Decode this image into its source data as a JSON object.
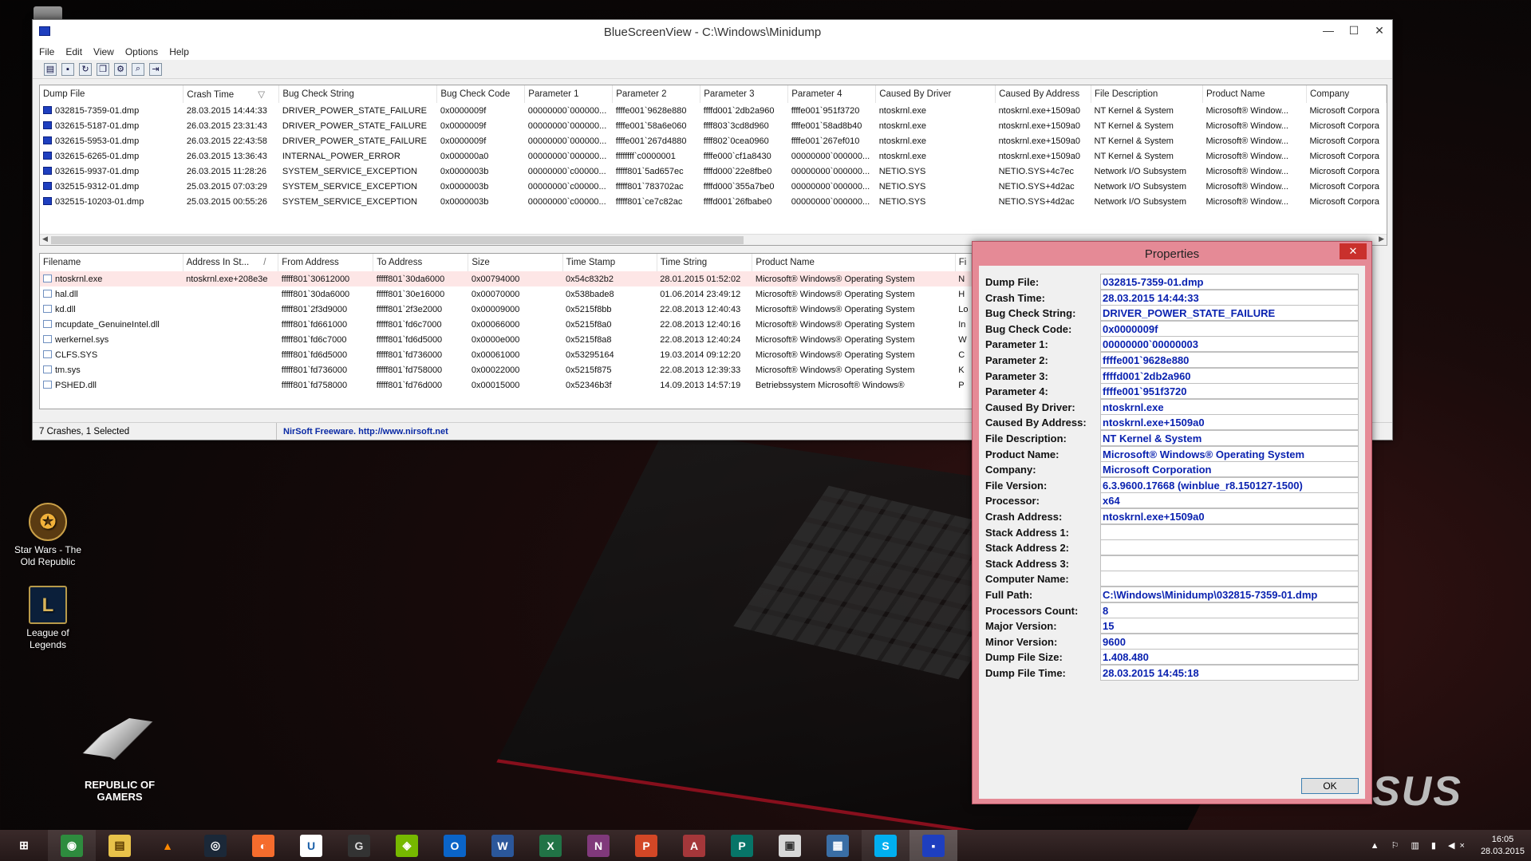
{
  "desktop": {
    "icons": [
      {
        "label": "Star Wars - The Old Republic",
        "icon": "swtor-icon"
      },
      {
        "label": "League of Legends",
        "icon": "league-icon"
      }
    ],
    "brand_text": "REPUBLIC OF GAMERS",
    "asus_text": "SUS"
  },
  "window": {
    "title": "BlueScreenView  -  C:\\Windows\\Minidump",
    "controls": {
      "minimize": "—",
      "maximize": "☐",
      "close": "✕"
    },
    "menu": [
      "File",
      "Edit",
      "View",
      "Options",
      "Help"
    ],
    "toolbar": [
      "properties-icon",
      "save-icon",
      "refresh-icon",
      "copy-icon",
      "options-icon",
      "find-icon",
      "exit-icon"
    ]
  },
  "dumps": {
    "columns": [
      "Dump File",
      "Crash Time",
      "Bug Check String",
      "Bug Check Code",
      "Parameter 1",
      "Parameter 2",
      "Parameter 3",
      "Parameter 4",
      "Caused By Driver",
      "Caused By Address",
      "File Description",
      "Product Name",
      "Company"
    ],
    "sort_indicator": "▽",
    "rows": [
      [
        "032815-7359-01.dmp",
        "28.03.2015 14:44:33",
        "DRIVER_POWER_STATE_FAILURE",
        "0x0000009f",
        "00000000`000000...",
        "ffffe001`9628e880",
        "ffffd001`2db2a960",
        "ffffe001`951f3720",
        "ntoskrnl.exe",
        "ntoskrnl.exe+1509a0",
        "NT Kernel & System",
        "Microsoft® Window...",
        "Microsoft Corpora"
      ],
      [
        "032615-5187-01.dmp",
        "26.03.2015 23:31:43",
        "DRIVER_POWER_STATE_FAILURE",
        "0x0000009f",
        "00000000`000000...",
        "ffffe001`58a6e060",
        "ffff803`3cd8d960",
        "ffffe001`58ad8b40",
        "ntoskrnl.exe",
        "ntoskrnl.exe+1509a0",
        "NT Kernel & System",
        "Microsoft® Window...",
        "Microsoft Corpora"
      ],
      [
        "032615-5953-01.dmp",
        "26.03.2015 22:43:58",
        "DRIVER_POWER_STATE_FAILURE",
        "0x0000009f",
        "00000000`000000...",
        "ffffe001`267d4880",
        "ffff802`0cea0960",
        "ffffe001`267ef010",
        "ntoskrnl.exe",
        "ntoskrnl.exe+1509a0",
        "NT Kernel & System",
        "Microsoft® Window...",
        "Microsoft Corpora"
      ],
      [
        "032615-6265-01.dmp",
        "26.03.2015 13:36:43",
        "INTERNAL_POWER_ERROR",
        "0x000000a0",
        "00000000`000000...",
        "ffffffff`c0000001",
        "ffffe000`cf1a8430",
        "00000000`000000...",
        "ntoskrnl.exe",
        "ntoskrnl.exe+1509a0",
        "NT Kernel & System",
        "Microsoft® Window...",
        "Microsoft Corpora"
      ],
      [
        "032615-9937-01.dmp",
        "26.03.2015 11:28:26",
        "SYSTEM_SERVICE_EXCEPTION",
        "0x0000003b",
        "00000000`c00000...",
        "fffff801`5ad657ec",
        "ffffd000`22e8fbe0",
        "00000000`000000...",
        "NETIO.SYS",
        "NETIO.SYS+4c7ec",
        "Network I/O Subsystem",
        "Microsoft® Window...",
        "Microsoft Corpora"
      ],
      [
        "032515-9312-01.dmp",
        "25.03.2015 07:03:29",
        "SYSTEM_SERVICE_EXCEPTION",
        "0x0000003b",
        "00000000`c00000...",
        "fffff801`783702ac",
        "ffffd000`355a7be0",
        "00000000`000000...",
        "NETIO.SYS",
        "NETIO.SYS+4d2ac",
        "Network I/O Subsystem",
        "Microsoft® Window...",
        "Microsoft Corpora"
      ],
      [
        "032515-10203-01.dmp",
        "25.03.2015 00:55:26",
        "SYSTEM_SERVICE_EXCEPTION",
        "0x0000003b",
        "00000000`c00000...",
        "fffff801`ce7c82ac",
        "ffffd001`26fbabe0",
        "00000000`000000...",
        "NETIO.SYS",
        "NETIO.SYS+4d2ac",
        "Network I/O Subsystem",
        "Microsoft® Window...",
        "Microsoft Corpora"
      ]
    ]
  },
  "modules": {
    "columns": [
      "Filename",
      "Address In St...",
      "From Address",
      "To Address",
      "Size",
      "Time Stamp",
      "Time String",
      "Product Name",
      "Fi"
    ],
    "sort_indicator": "/",
    "rows": [
      [
        "ntoskrnl.exe",
        "ntoskrnl.exe+208e3e",
        "fffff801`30612000",
        "fffff801`30da6000",
        "0x00794000",
        "0x54c832b2",
        "28.01.2015 01:52:02",
        "Microsoft® Windows® Operating System",
        "N"
      ],
      [
        "hal.dll",
        "",
        "fffff801`30da6000",
        "fffff801`30e16000",
        "0x00070000",
        "0x538bade8",
        "01.06.2014 23:49:12",
        "Microsoft® Windows® Operating System",
        "H"
      ],
      [
        "kd.dll",
        "",
        "fffff801`2f3d9000",
        "fffff801`2f3e2000",
        "0x00009000",
        "0x5215f8bb",
        "22.08.2013 12:40:43",
        "Microsoft® Windows® Operating System",
        "Lo"
      ],
      [
        "mcupdate_GenuineIntel.dll",
        "",
        "fffff801`fd661000",
        "fffff801`fd6c7000",
        "0x00066000",
        "0x5215f8a0",
        "22.08.2013 12:40:16",
        "Microsoft® Windows® Operating System",
        "In"
      ],
      [
        "werkernel.sys",
        "",
        "fffff801`fd6c7000",
        "fffff801`fd6d5000",
        "0x0000e000",
        "0x5215f8a8",
        "22.08.2013 12:40:24",
        "Microsoft® Windows® Operating System",
        "W"
      ],
      [
        "CLFS.SYS",
        "",
        "fffff801`fd6d5000",
        "fffff801`fd736000",
        "0x00061000",
        "0x53295164",
        "19.03.2014 09:12:20",
        "Microsoft® Windows® Operating System",
        "C"
      ],
      [
        "tm.sys",
        "",
        "fffff801`fd736000",
        "fffff801`fd758000",
        "0x00022000",
        "0x5215f875",
        "22.08.2013 12:39:33",
        "Microsoft® Windows® Operating System",
        "K"
      ],
      [
        "PSHED.dll",
        "",
        "fffff801`fd758000",
        "fffff801`fd76d000",
        "0x00015000",
        "0x52346b3f",
        "14.09.2013 14:57:19",
        "Betriebssystem Microsoft® Windows®",
        "P"
      ]
    ]
  },
  "status": {
    "count": "7 Crashes, 1 Selected",
    "link": "NirSoft Freeware.  http://www.nirsoft.net"
  },
  "properties": {
    "title": "Properties",
    "close": "✕",
    "ok": "OK",
    "fields": [
      {
        "label": "Dump File:",
        "value": "032815-7359-01.dmp"
      },
      {
        "label": "Crash Time:",
        "value": "28.03.2015 14:44:33"
      },
      {
        "label": "Bug Check String:",
        "value": "DRIVER_POWER_STATE_FAILURE"
      },
      {
        "label": "Bug Check Code:",
        "value": "0x0000009f"
      },
      {
        "label": "Parameter 1:",
        "value": "00000000`00000003"
      },
      {
        "label": "Parameter 2:",
        "value": "ffffe001`9628e880"
      },
      {
        "label": "Parameter 3:",
        "value": "ffffd001`2db2a960"
      },
      {
        "label": "Parameter 4:",
        "value": "ffffe001`951f3720"
      },
      {
        "label": "Caused By Driver:",
        "value": "ntoskrnl.exe"
      },
      {
        "label": "Caused By Address:",
        "value": "ntoskrnl.exe+1509a0"
      },
      {
        "label": "File Description:",
        "value": "NT Kernel & System"
      },
      {
        "label": "Product Name:",
        "value": "Microsoft® Windows® Operating System"
      },
      {
        "label": "Company:",
        "value": "Microsoft Corporation"
      },
      {
        "label": "File Version:",
        "value": "6.3.9600.17668 (winblue_r8.150127-1500)"
      },
      {
        "label": "Processor:",
        "value": "x64"
      },
      {
        "label": "Crash Address:",
        "value": "ntoskrnl.exe+1509a0"
      },
      {
        "label": "Stack Address 1:",
        "value": ""
      },
      {
        "label": "Stack Address 2:",
        "value": ""
      },
      {
        "label": "Stack Address 3:",
        "value": ""
      },
      {
        "label": "Computer Name:",
        "value": ""
      },
      {
        "label": "Full Path:",
        "value": "C:\\Windows\\Minidump\\032815-7359-01.dmp"
      },
      {
        "label": "Processors Count:",
        "value": "8"
      },
      {
        "label": "Major Version:",
        "value": "15"
      },
      {
        "label": "Minor Version:",
        "value": "9600"
      },
      {
        "label": "Dump File Size:",
        "value": "1.408.480"
      },
      {
        "label": "Dump File Time:",
        "value": "28.03.2015 14:45:18"
      }
    ]
  },
  "taskbar": {
    "items": [
      {
        "name": "start-icon",
        "glyph": "⊞",
        "color": "#ffffff",
        "bg": "transparent"
      },
      {
        "name": "chrome-icon",
        "glyph": "◉",
        "color": "#ffffff",
        "bg": "#2e8b3e"
      },
      {
        "name": "explorer-icon",
        "glyph": "▤",
        "color": "#5a3a00",
        "bg": "#e8c24a"
      },
      {
        "name": "vlc-icon",
        "glyph": "▲",
        "color": "#ff8800",
        "bg": "transparent"
      },
      {
        "name": "steam-icon",
        "glyph": "◎",
        "color": "#ffffff",
        "bg": "#1b2838"
      },
      {
        "name": "origin-icon",
        "glyph": "◐",
        "color": "#ffffff",
        "bg": "#f56c2d"
      },
      {
        "name": "uplay-icon",
        "glyph": "U",
        "color": "#1a5fa8",
        "bg": "#ffffff"
      },
      {
        "name": "logitech-icon",
        "glyph": "G",
        "color": "#dddddd",
        "bg": "#333333"
      },
      {
        "name": "nvidia-icon",
        "glyph": "◈",
        "color": "#ffffff",
        "bg": "#76b900"
      },
      {
        "name": "outlook-icon",
        "glyph": "O",
        "color": "#ffffff",
        "bg": "#0a64c8"
      },
      {
        "name": "word-icon",
        "glyph": "W",
        "color": "#ffffff",
        "bg": "#2b579a"
      },
      {
        "name": "excel-icon",
        "glyph": "X",
        "color": "#ffffff",
        "bg": "#217346"
      },
      {
        "name": "onenote-icon",
        "glyph": "N",
        "color": "#ffffff",
        "bg": "#80397b"
      },
      {
        "name": "powerpoint-icon",
        "glyph": "P",
        "color": "#ffffff",
        "bg": "#d24726"
      },
      {
        "name": "access-icon",
        "glyph": "A",
        "color": "#ffffff",
        "bg": "#a4373a"
      },
      {
        "name": "publisher-icon",
        "glyph": "P",
        "color": "#ffffff",
        "bg": "#077568"
      },
      {
        "name": "remote-desktop-icon",
        "glyph": "▣",
        "color": "#333333",
        "bg": "#d8d8d8"
      },
      {
        "name": "network-icon",
        "glyph": "▦",
        "color": "#ffffff",
        "bg": "#3a6ea5"
      },
      {
        "name": "skype-icon",
        "glyph": "S",
        "color": "#ffffff",
        "bg": "#00aff0"
      },
      {
        "name": "bluescreenview-icon",
        "glyph": "▪",
        "color": "#ffffff",
        "bg": "#1e3fbf"
      }
    ],
    "tray": "▲ ⚐ ▥ ▮ ◀×",
    "time": "16:05",
    "date": "28.03.2015"
  }
}
